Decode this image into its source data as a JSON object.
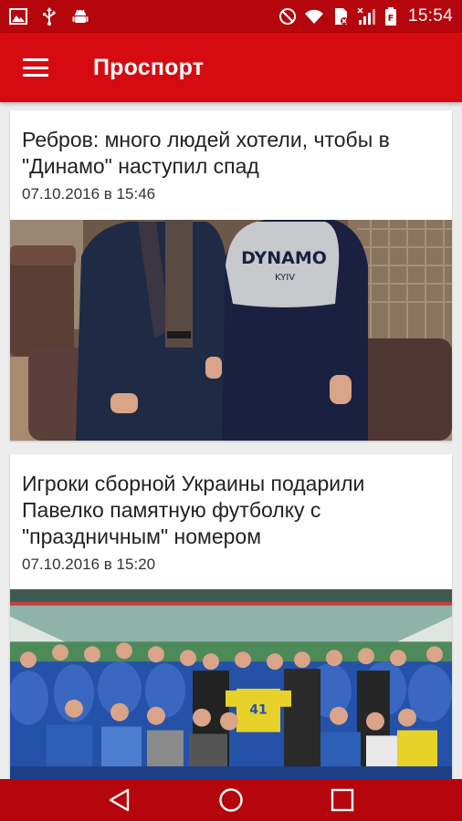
{
  "status_bar": {
    "time": "15:54",
    "left_icons": [
      "image-icon",
      "usb-icon",
      "android-icon"
    ],
    "right_icons": [
      "do-not-disturb-icon",
      "wifi-icon",
      "sim-icon",
      "signal-icon",
      "battery-icon"
    ]
  },
  "app_bar": {
    "title": "Проспорт",
    "menu_icon": "hamburger-menu-icon"
  },
  "articles": [
    {
      "title": "Ребров: много людей хотели, чтобы в \"Динамо\" наступил спад",
      "date": "07.10.2016 в 15:46",
      "image_alt": "Two men standing indoors, one in a dark suit and one in a Dynamo Kyiv sweatshirt",
      "shirt_text": "DYNAMO",
      "shirt_subtext": "KYIV"
    },
    {
      "title": "Игроки сборной Украины подарили Павелко памятную футболку с \"праздничным\" номером",
      "date": "07.10.2016 в 15:20",
      "image_alt": "Ukraine national team players posing with a yellow jersey in a stadium",
      "jersey_number": "41"
    }
  ],
  "nav_bar": {
    "back_icon": "back-triangle-icon",
    "home_icon": "home-circle-icon",
    "recents_icon": "recents-square-icon"
  },
  "colors": {
    "status_bar": "#b4060c",
    "app_bar": "#d60b12",
    "background": "#ececec"
  }
}
